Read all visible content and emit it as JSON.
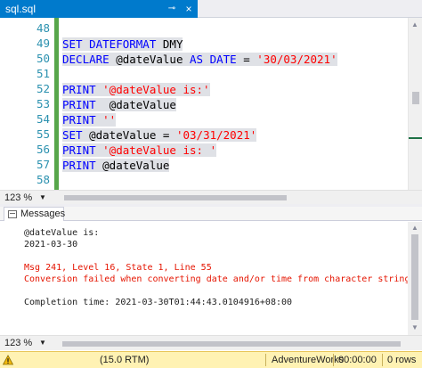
{
  "tab": {
    "title": "sql.sql",
    "pin_glyph": "⊸",
    "close_glyph": "×"
  },
  "editor": {
    "line_numbers": [
      "48",
      "49",
      "50",
      "51",
      "52",
      "53",
      "54",
      "55",
      "56",
      "57",
      "58"
    ],
    "lines": [
      {
        "parts": []
      },
      {
        "parts": [
          {
            "t": "SET DATEFORMAT ",
            "c": "kw"
          },
          {
            "t": "DMY",
            "c": "var"
          }
        ]
      },
      {
        "parts": [
          {
            "t": "DECLARE ",
            "c": "kw"
          },
          {
            "t": "@dateValue ",
            "c": "var"
          },
          {
            "t": "AS DATE ",
            "c": "kw"
          },
          {
            "t": "= ",
            "c": "var"
          },
          {
            "t": "'30/03/2021'",
            "c": "str"
          }
        ]
      },
      {
        "parts": []
      },
      {
        "parts": [
          {
            "t": "PRINT ",
            "c": "kw"
          },
          {
            "t": "'@dateValue is:'",
            "c": "str"
          }
        ]
      },
      {
        "parts": [
          {
            "t": "PRINT  ",
            "c": "kw"
          },
          {
            "t": "@dateValue",
            "c": "var"
          }
        ]
      },
      {
        "parts": [
          {
            "t": "PRINT ",
            "c": "kw"
          },
          {
            "t": "''",
            "c": "str"
          }
        ]
      },
      {
        "parts": [
          {
            "t": "SET ",
            "c": "kw"
          },
          {
            "t": "@dateValue ",
            "c": "var"
          },
          {
            "t": "= ",
            "c": "var"
          },
          {
            "t": "'03/31/2021'",
            "c": "str"
          }
        ]
      },
      {
        "parts": [
          {
            "t": "PRINT ",
            "c": "kw"
          },
          {
            "t": "'@dateValue is: '",
            "c": "str"
          }
        ]
      },
      {
        "parts": [
          {
            "t": "PRINT ",
            "c": "kw"
          },
          {
            "t": "@dateValue",
            "c": "var"
          }
        ]
      },
      {
        "parts": []
      }
    ],
    "zoom": "123 %"
  },
  "results": {
    "messages_tab": "Messages",
    "lines": [
      {
        "text": "@dateValue is:",
        "kind": "normal"
      },
      {
        "text": "2021-03-30",
        "kind": "normal"
      },
      {
        "text": "",
        "kind": "normal"
      },
      {
        "text": "Msg 241, Level 16, State 1, Line 55",
        "kind": "error"
      },
      {
        "text": "Conversion failed when converting date and/or time from character string.",
        "kind": "error"
      },
      {
        "text": "",
        "kind": "normal"
      },
      {
        "text": "Completion time: 2021-03-30T01:44:43.0104916+08:00",
        "kind": "normal"
      }
    ],
    "zoom": "123 %"
  },
  "status": {
    "server": "(15.0 RTM)",
    "database": "AdventureWorks",
    "elapsed": "00:00:00",
    "rows": "0 rows"
  },
  "colors": {
    "tab_active": "#007acc",
    "keyword": "#0000ff",
    "string": "#ff0000",
    "error": "#e51400",
    "change_bar": "#57a64a",
    "status_bar": "#fff2b3"
  }
}
